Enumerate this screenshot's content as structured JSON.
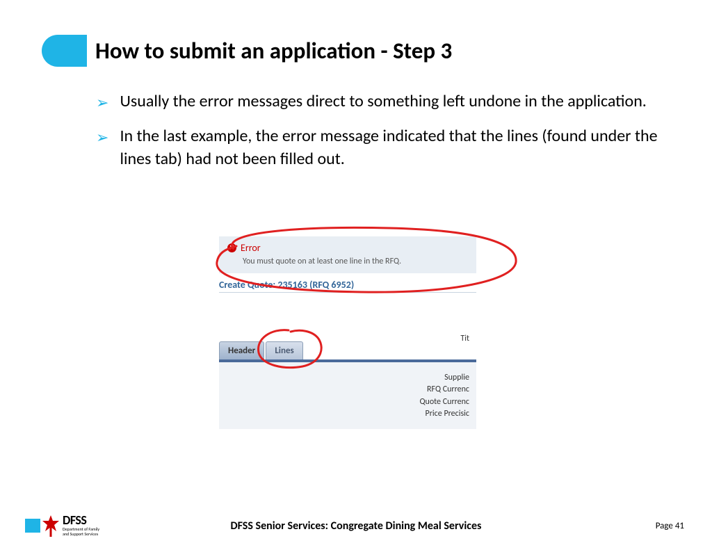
{
  "title": "How to submit an application - Step 3",
  "bullets": [
    "Usually the error messages direct to something left undone in the application.",
    "In the last example, the error message indicated that the lines (found under the lines tab) had not been filled out."
  ],
  "screenshot": {
    "error_label": "Error",
    "error_msg": "You must quote on at least one line in the RFQ.",
    "quote_title": "Create Quote: 235163 (RFQ 6952)",
    "tit": "Tit",
    "tabs": {
      "header": "Header",
      "lines": "Lines"
    },
    "fields": {
      "supplier": "Supplie",
      "rfq_currency": "RFQ Currenc",
      "quote_currency": "Quote Currenc",
      "price_precision": "Price Precisic"
    }
  },
  "footer": {
    "logo_big": "DFSS",
    "logo_small1": "Department of Family",
    "logo_small2": "and Support Services",
    "center": "DFSS Senior Services: Congregate Dining Meal Services",
    "page_label": "Page 41"
  }
}
